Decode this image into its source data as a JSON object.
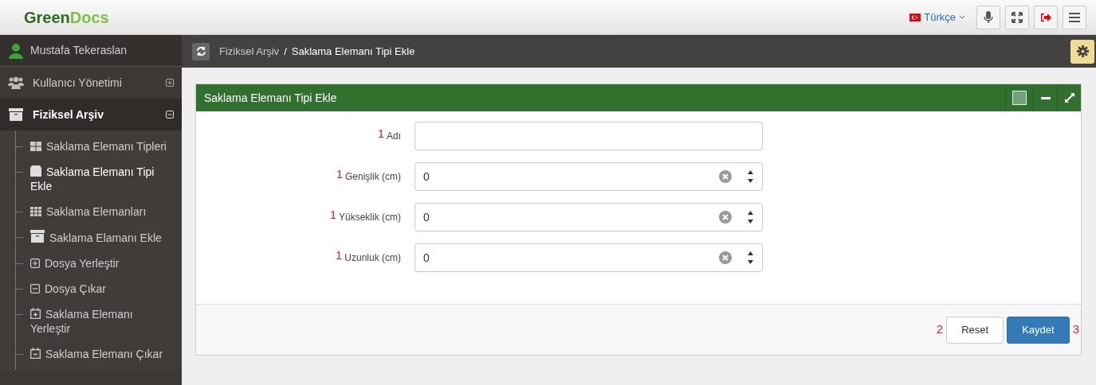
{
  "header": {
    "logo_part1": "Green",
    "logo_part2": "Docs",
    "language": "Türkçe"
  },
  "sidebar": {
    "user": "Mustafa Tekeraslan",
    "items": [
      {
        "label": "Kullanıcı Yönetimi",
        "expanded": false,
        "selected": false
      },
      {
        "label": "Fiziksel Arşiv",
        "expanded": true,
        "selected": true,
        "children": [
          {
            "label": "Saklama Elemanı Tipleri",
            "selected": false
          },
          {
            "label": "Saklama Elemanı Tipi Ekle",
            "selected": true
          },
          {
            "label": "Saklama Elemanları",
            "selected": false
          },
          {
            "label": "Saklama Elamanı Ekle",
            "selected": false
          },
          {
            "label": "Dosya Yerleştir",
            "selected": false
          },
          {
            "label": "Dosya Çıkar",
            "selected": false
          },
          {
            "label": "Saklama Elemanı Yerleştir",
            "selected": false
          },
          {
            "label": "Saklama Elemanı Çıkar",
            "selected": false
          }
        ]
      }
    ]
  },
  "breadcrumb": [
    "Fiziksel Arşiv",
    "/",
    "Saklama Elemanı Tipi Ekle"
  ],
  "panel": {
    "title": "Saklama Elemanı Tipi Ekle",
    "fields": [
      {
        "marker": "1",
        "label": "Adı",
        "kind": "text"
      },
      {
        "marker": "1",
        "label": "Genişlik (cm)",
        "kind": "number",
        "value": "0"
      },
      {
        "marker": "1",
        "label": "Yükseklik (cm)",
        "kind": "number",
        "value": "0"
      },
      {
        "marker": "1",
        "label": "Uzunluk (cm)",
        "kind": "number",
        "value": "0"
      }
    ],
    "buttons": [
      {
        "marker": "2",
        "label": "Reset",
        "kind": "default"
      },
      {
        "marker": "3",
        "label": "Kaydet",
        "kind": "primary"
      }
    ]
  }
}
